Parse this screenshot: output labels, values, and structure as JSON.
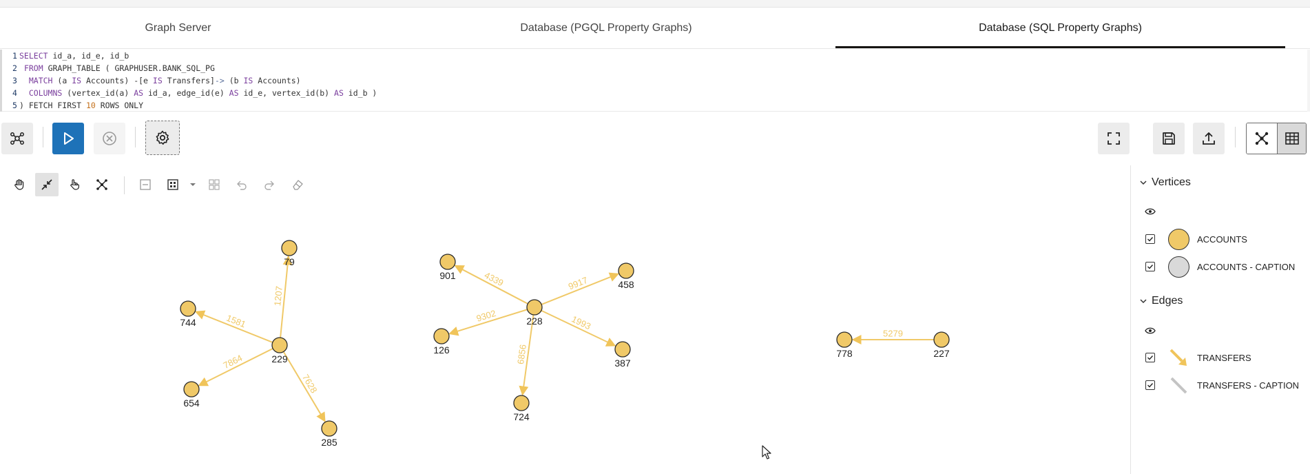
{
  "tabs": [
    {
      "label": "Graph Server"
    },
    {
      "label": "Database (PGQL Property Graphs)"
    },
    {
      "label": "Database (SQL Property Graphs)"
    }
  ],
  "query": {
    "line_numbers": [
      "1",
      "2",
      "3",
      "4",
      "5"
    ],
    "l1_kw": "SELECT",
    "l1_rest": " id_a, id_e, id_b",
    "l2_kw": "FROM",
    "l2_rest": " GRAPH_TABLE ( GRAPHUSER.BANK_SQL_PG",
    "l3_kw": "MATCH",
    "l3_a": " (a ",
    "l3_is1": "IS",
    "l3_b": " Accounts) -[e ",
    "l3_is2": "IS",
    "l3_c": " Transfers]",
    "l3_arrow": "->",
    "l3_d": " (b ",
    "l3_is3": "IS",
    "l3_e": " Accounts)",
    "l4_kw": "COLUMNS",
    "l4_a": " (vertex_id(a) ",
    "l4_as1": "AS",
    "l4_b": " id_a, edge_id(e) ",
    "l4_as2": "AS",
    "l4_c": " id_e, vertex_id(b) ",
    "l4_as3": "AS",
    "l4_d": " id_b )",
    "l5_a": ") FETCH FIRST ",
    "l5_num": "10",
    "l5_b": " ROWS ONLY"
  },
  "legend": {
    "vertices_label": "Vertices",
    "edges_label": "Edges",
    "vertex_items": [
      {
        "label": "ACCOUNTS",
        "color": "#f0c968"
      },
      {
        "label": "ACCOUNTS - CAPTION",
        "color": "#d9d9d9"
      }
    ],
    "edge_items": [
      {
        "label": "TRANSFERS",
        "color": "#f0c45a"
      },
      {
        "label": "TRANSFERS - CAPTION",
        "color": "#c4c4c4"
      }
    ]
  },
  "graph": {
    "node_color": "#f0c968",
    "edge_color": "#f0c968",
    "nodes": [
      {
        "id": "79"
      },
      {
        "id": "744"
      },
      {
        "id": "229"
      },
      {
        "id": "654"
      },
      {
        "id": "285"
      },
      {
        "id": "901"
      },
      {
        "id": "458"
      },
      {
        "id": "228"
      },
      {
        "id": "126"
      },
      {
        "id": "387"
      },
      {
        "id": "724"
      },
      {
        "id": "778"
      },
      {
        "id": "227"
      }
    ],
    "edges": [
      {
        "from": "229",
        "to": "79",
        "label": "1207"
      },
      {
        "from": "229",
        "to": "744",
        "label": "1581"
      },
      {
        "from": "229",
        "to": "654",
        "label": "7864"
      },
      {
        "from": "229",
        "to": "285",
        "label": "7628"
      },
      {
        "from": "228",
        "to": "901",
        "label": "4339"
      },
      {
        "from": "228",
        "to": "458",
        "label": "9917"
      },
      {
        "from": "228",
        "to": "126",
        "label": "9302"
      },
      {
        "from": "228",
        "to": "387",
        "label": "1993"
      },
      {
        "from": "228",
        "to": "724",
        "label": "6856"
      },
      {
        "from": "227",
        "to": "778",
        "label": "5279"
      }
    ]
  }
}
